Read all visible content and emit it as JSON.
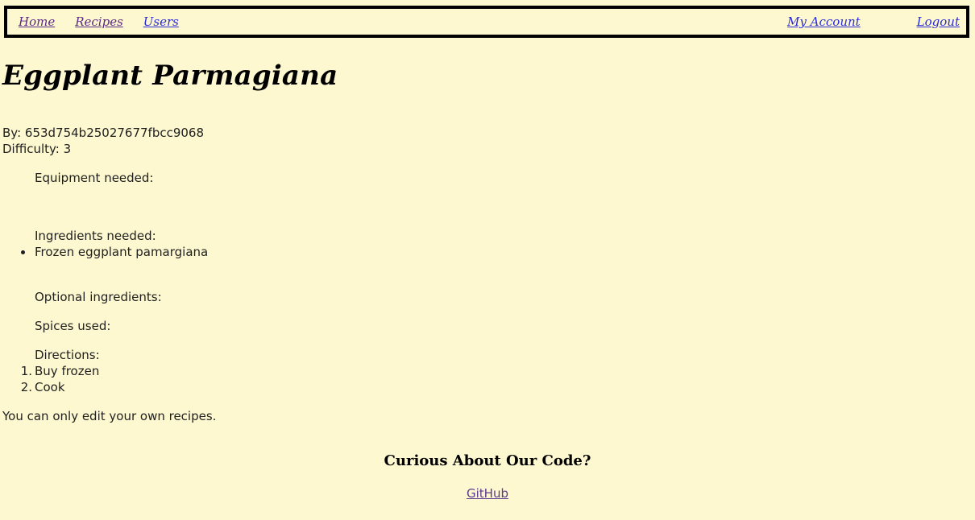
{
  "nav": {
    "home": "Home",
    "recipes": "Recipes",
    "users": "Users",
    "account": "My Account",
    "logout": "Logout"
  },
  "recipe": {
    "title": "Eggplant Parmagiana",
    "by": "By: 653d754b25027677fbcc9068",
    "difficulty": "Difficulty: 3",
    "equipment_label": "Equipment needed:",
    "ingredients_label": "Ingredients needed:",
    "ingredients": [
      "Frozen eggplant pamargiana"
    ],
    "optional_label": "Optional ingredients:",
    "spices_label": "Spices used:",
    "directions_label": "Directions:",
    "directions": [
      "Buy frozen",
      "Cook"
    ]
  },
  "edit_note": "You can only edit your own recipes.",
  "footer": {
    "heading": "Curious About Our Code?",
    "link": "GitHub"
  },
  "colors": {
    "background": "#fdf8cf",
    "visited_link": "#5b2a86",
    "link": "#2a2adb"
  }
}
